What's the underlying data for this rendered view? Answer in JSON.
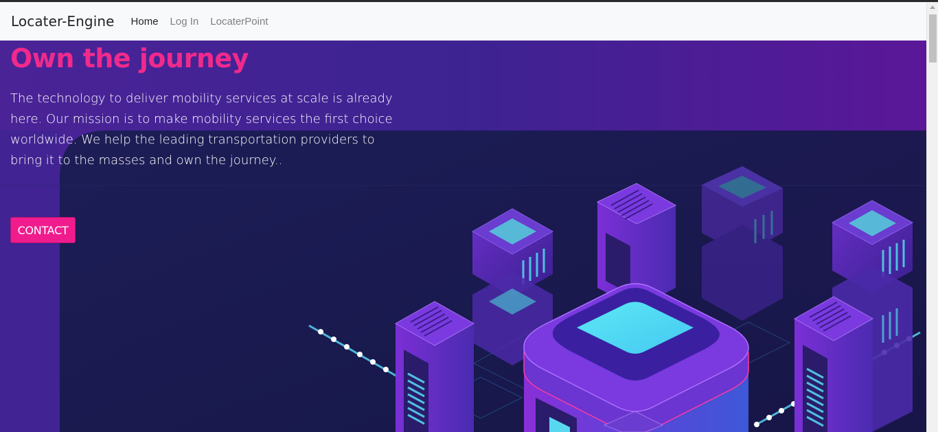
{
  "navbar": {
    "brand": "Locater-Engine",
    "links": [
      {
        "label": "Home",
        "active": true
      },
      {
        "label": "Log In",
        "active": false
      },
      {
        "label": "LocaterPoint",
        "active": false
      }
    ]
  },
  "hero": {
    "title": "Own the journey",
    "text": "The technology to deliver mobility services at scale is already here. Our mission is to make mobility services the first choice worldwide. We help the leading transportation providers to bring it to the masses and own the journey..",
    "contact_label": "CONTACT",
    "image_icon": "isometric-servers-illustration"
  },
  "colors": {
    "navbar_bg": "#f8f9fa",
    "hero_purple": "#4a2397",
    "hero_navy": "#161a4a",
    "accent_pink": "#f01c8d",
    "title_pink": "#f02a8c"
  }
}
